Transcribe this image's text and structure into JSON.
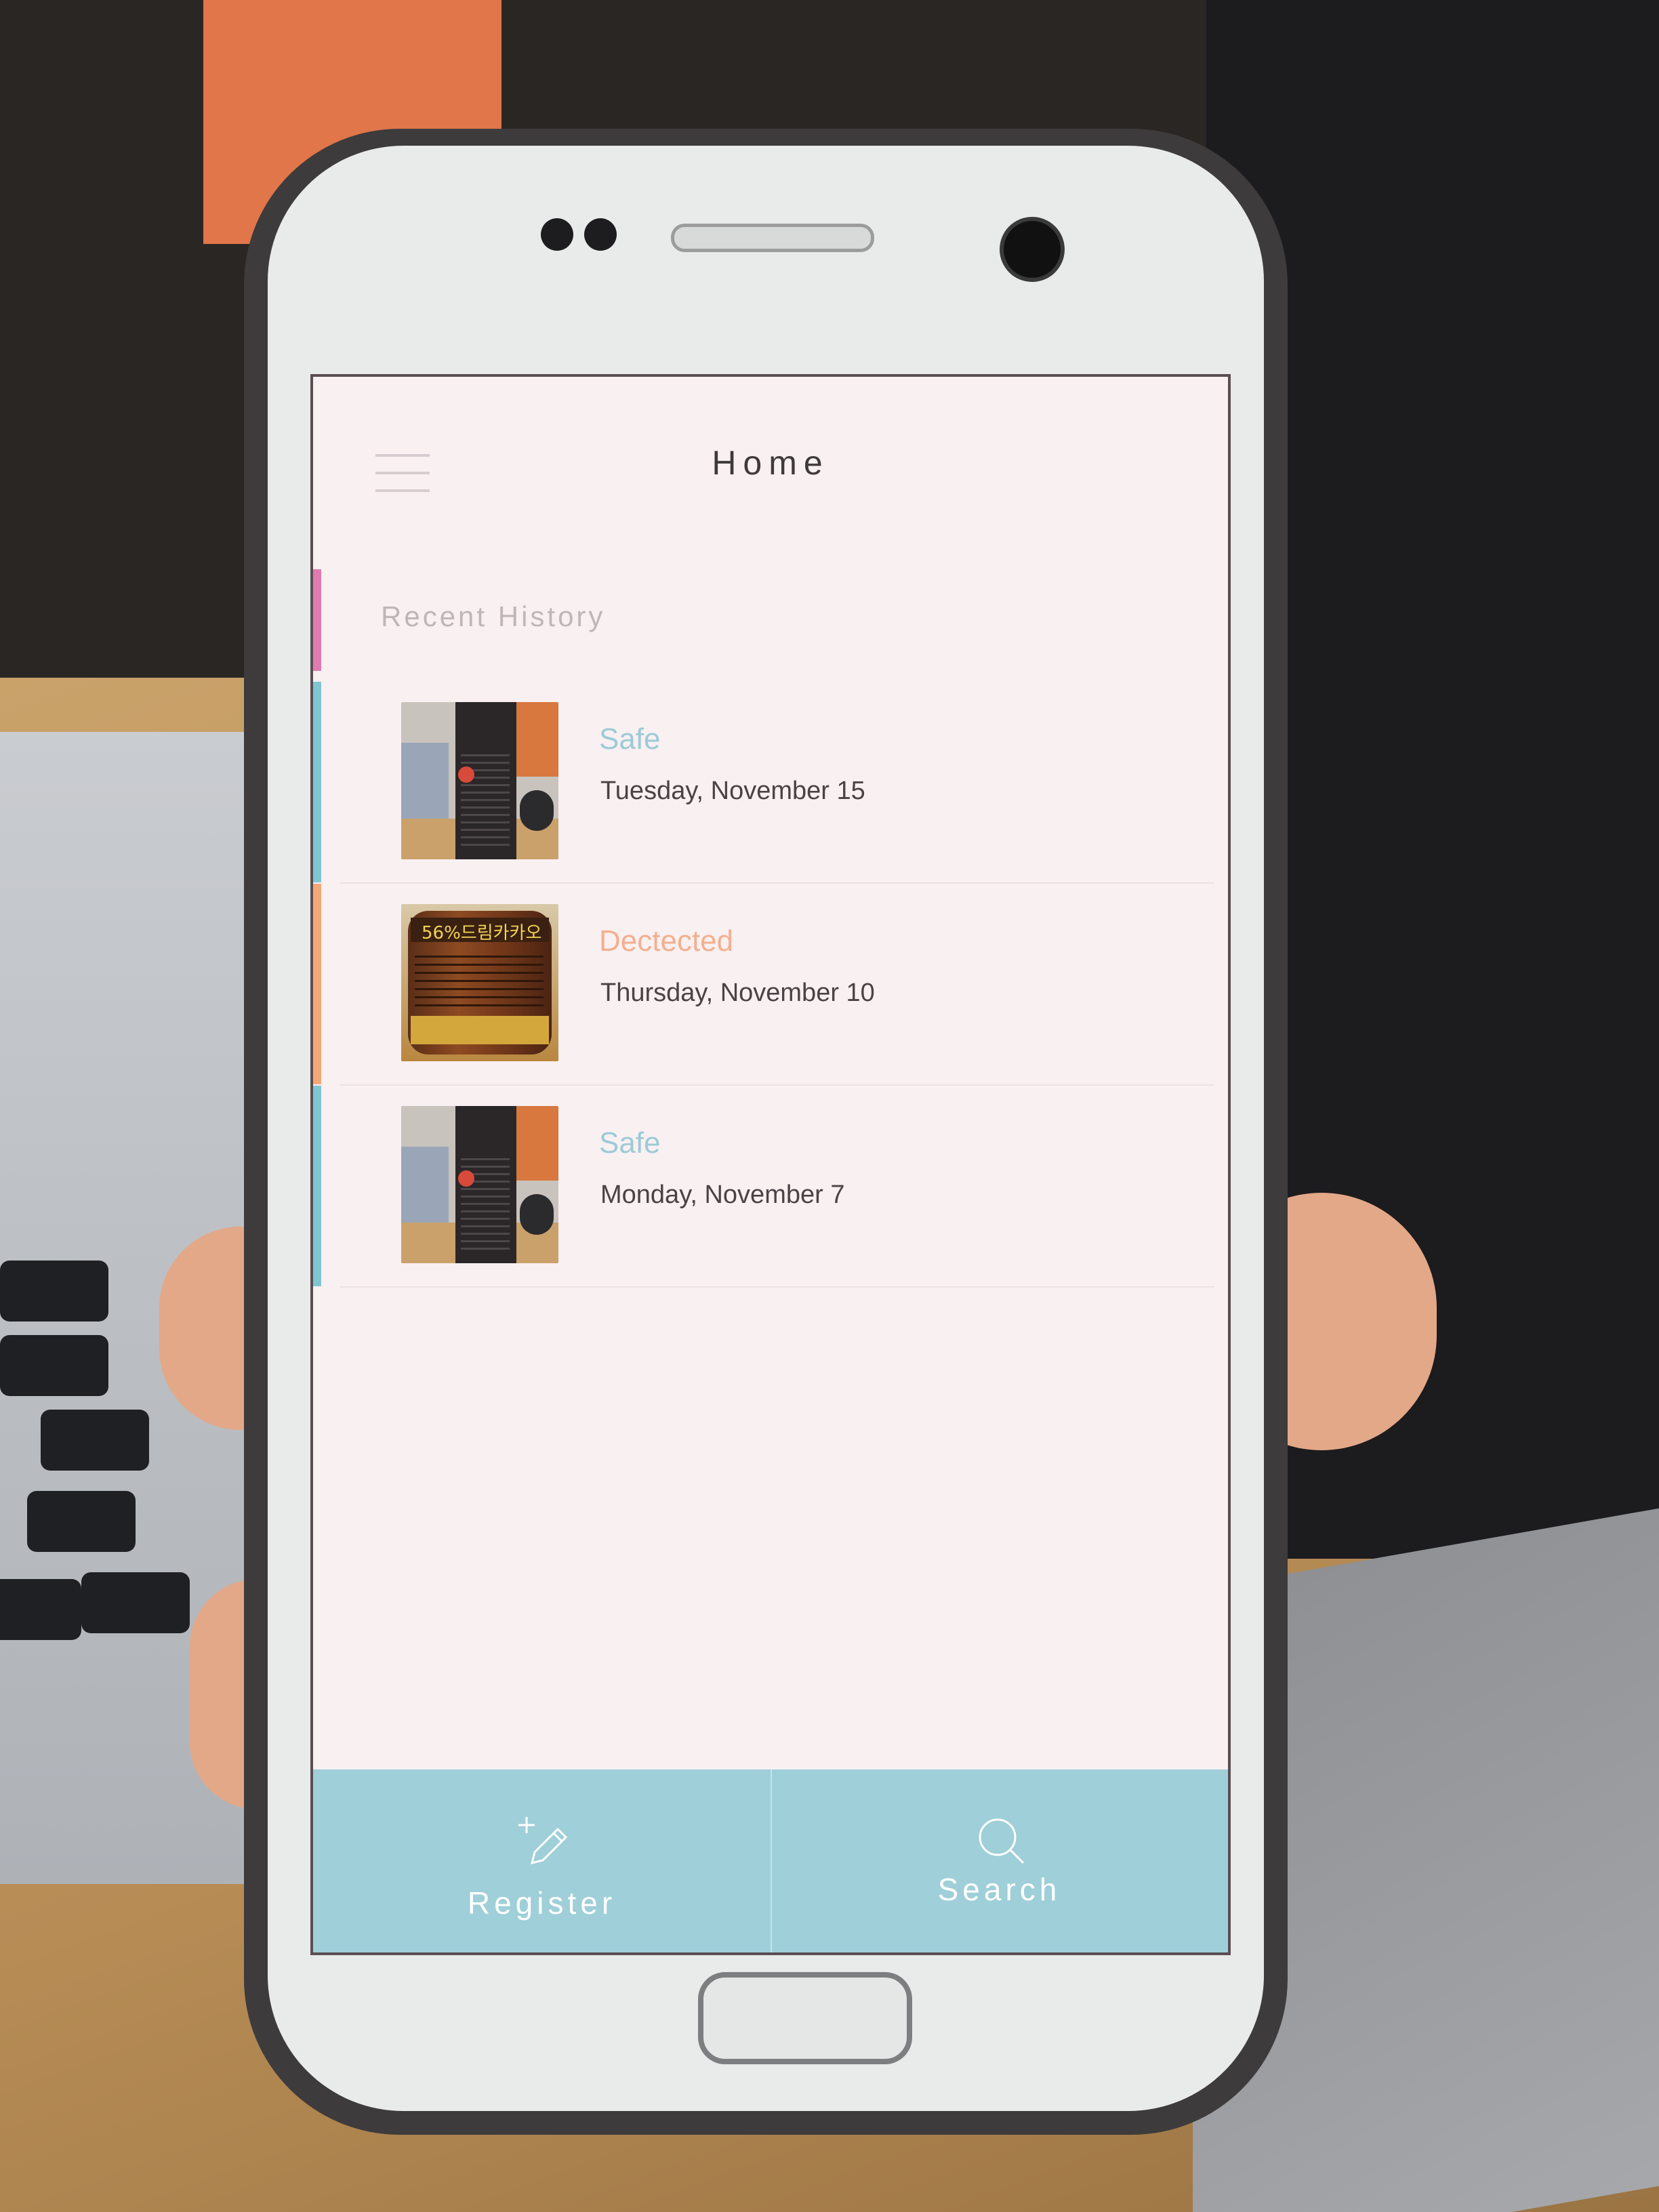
{
  "app": {
    "title": "Home"
  },
  "history": {
    "section_title": "Recent History",
    "items": [
      {
        "status": "Safe",
        "status_color": "#9ccbd6",
        "stripe_color": "#7fc6d1",
        "date": "Tuesday, November 15"
      },
      {
        "status": "Dectected",
        "status_color": "#f2b08e",
        "stripe_color": "#f4a777",
        "date": "Thursday, November 10",
        "thumb_text": "56%드림카카오"
      },
      {
        "status": "Safe",
        "status_color": "#9ccbd6",
        "stripe_color": "#7fc6d1",
        "date": "Monday, November 7"
      }
    ]
  },
  "bottom_bar": {
    "register_label": "Register",
    "search_label": "Search",
    "register_icon": "pencil-plus-icon",
    "search_icon": "magnifier-icon",
    "background": "#9fcfd8"
  },
  "colors": {
    "screen_background": "#f9f0f2",
    "accent_pink": "#e07bb0"
  }
}
